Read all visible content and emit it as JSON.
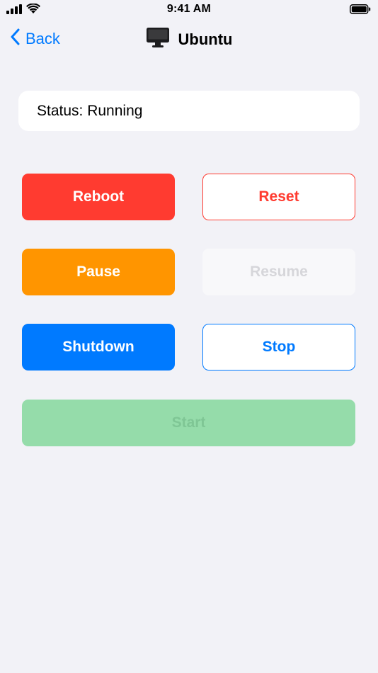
{
  "status_bar": {
    "time": "9:41 AM"
  },
  "nav": {
    "back_label": "Back",
    "title": "Ubuntu",
    "title_icon": "desktop-computer-icon"
  },
  "status": {
    "text": "Status: Running"
  },
  "actions": {
    "reboot": "Reboot",
    "reset": "Reset",
    "pause": "Pause",
    "resume": "Resume",
    "shutdown": "Shutdown",
    "stop": "Stop",
    "start": "Start"
  },
  "colors": {
    "background": "#f2f2f7",
    "red": "#ff3b30",
    "orange": "#ff9500",
    "blue": "#007aff",
    "green_disabled": "#95dcaa",
    "gray_disabled": "#f8f8fa"
  }
}
